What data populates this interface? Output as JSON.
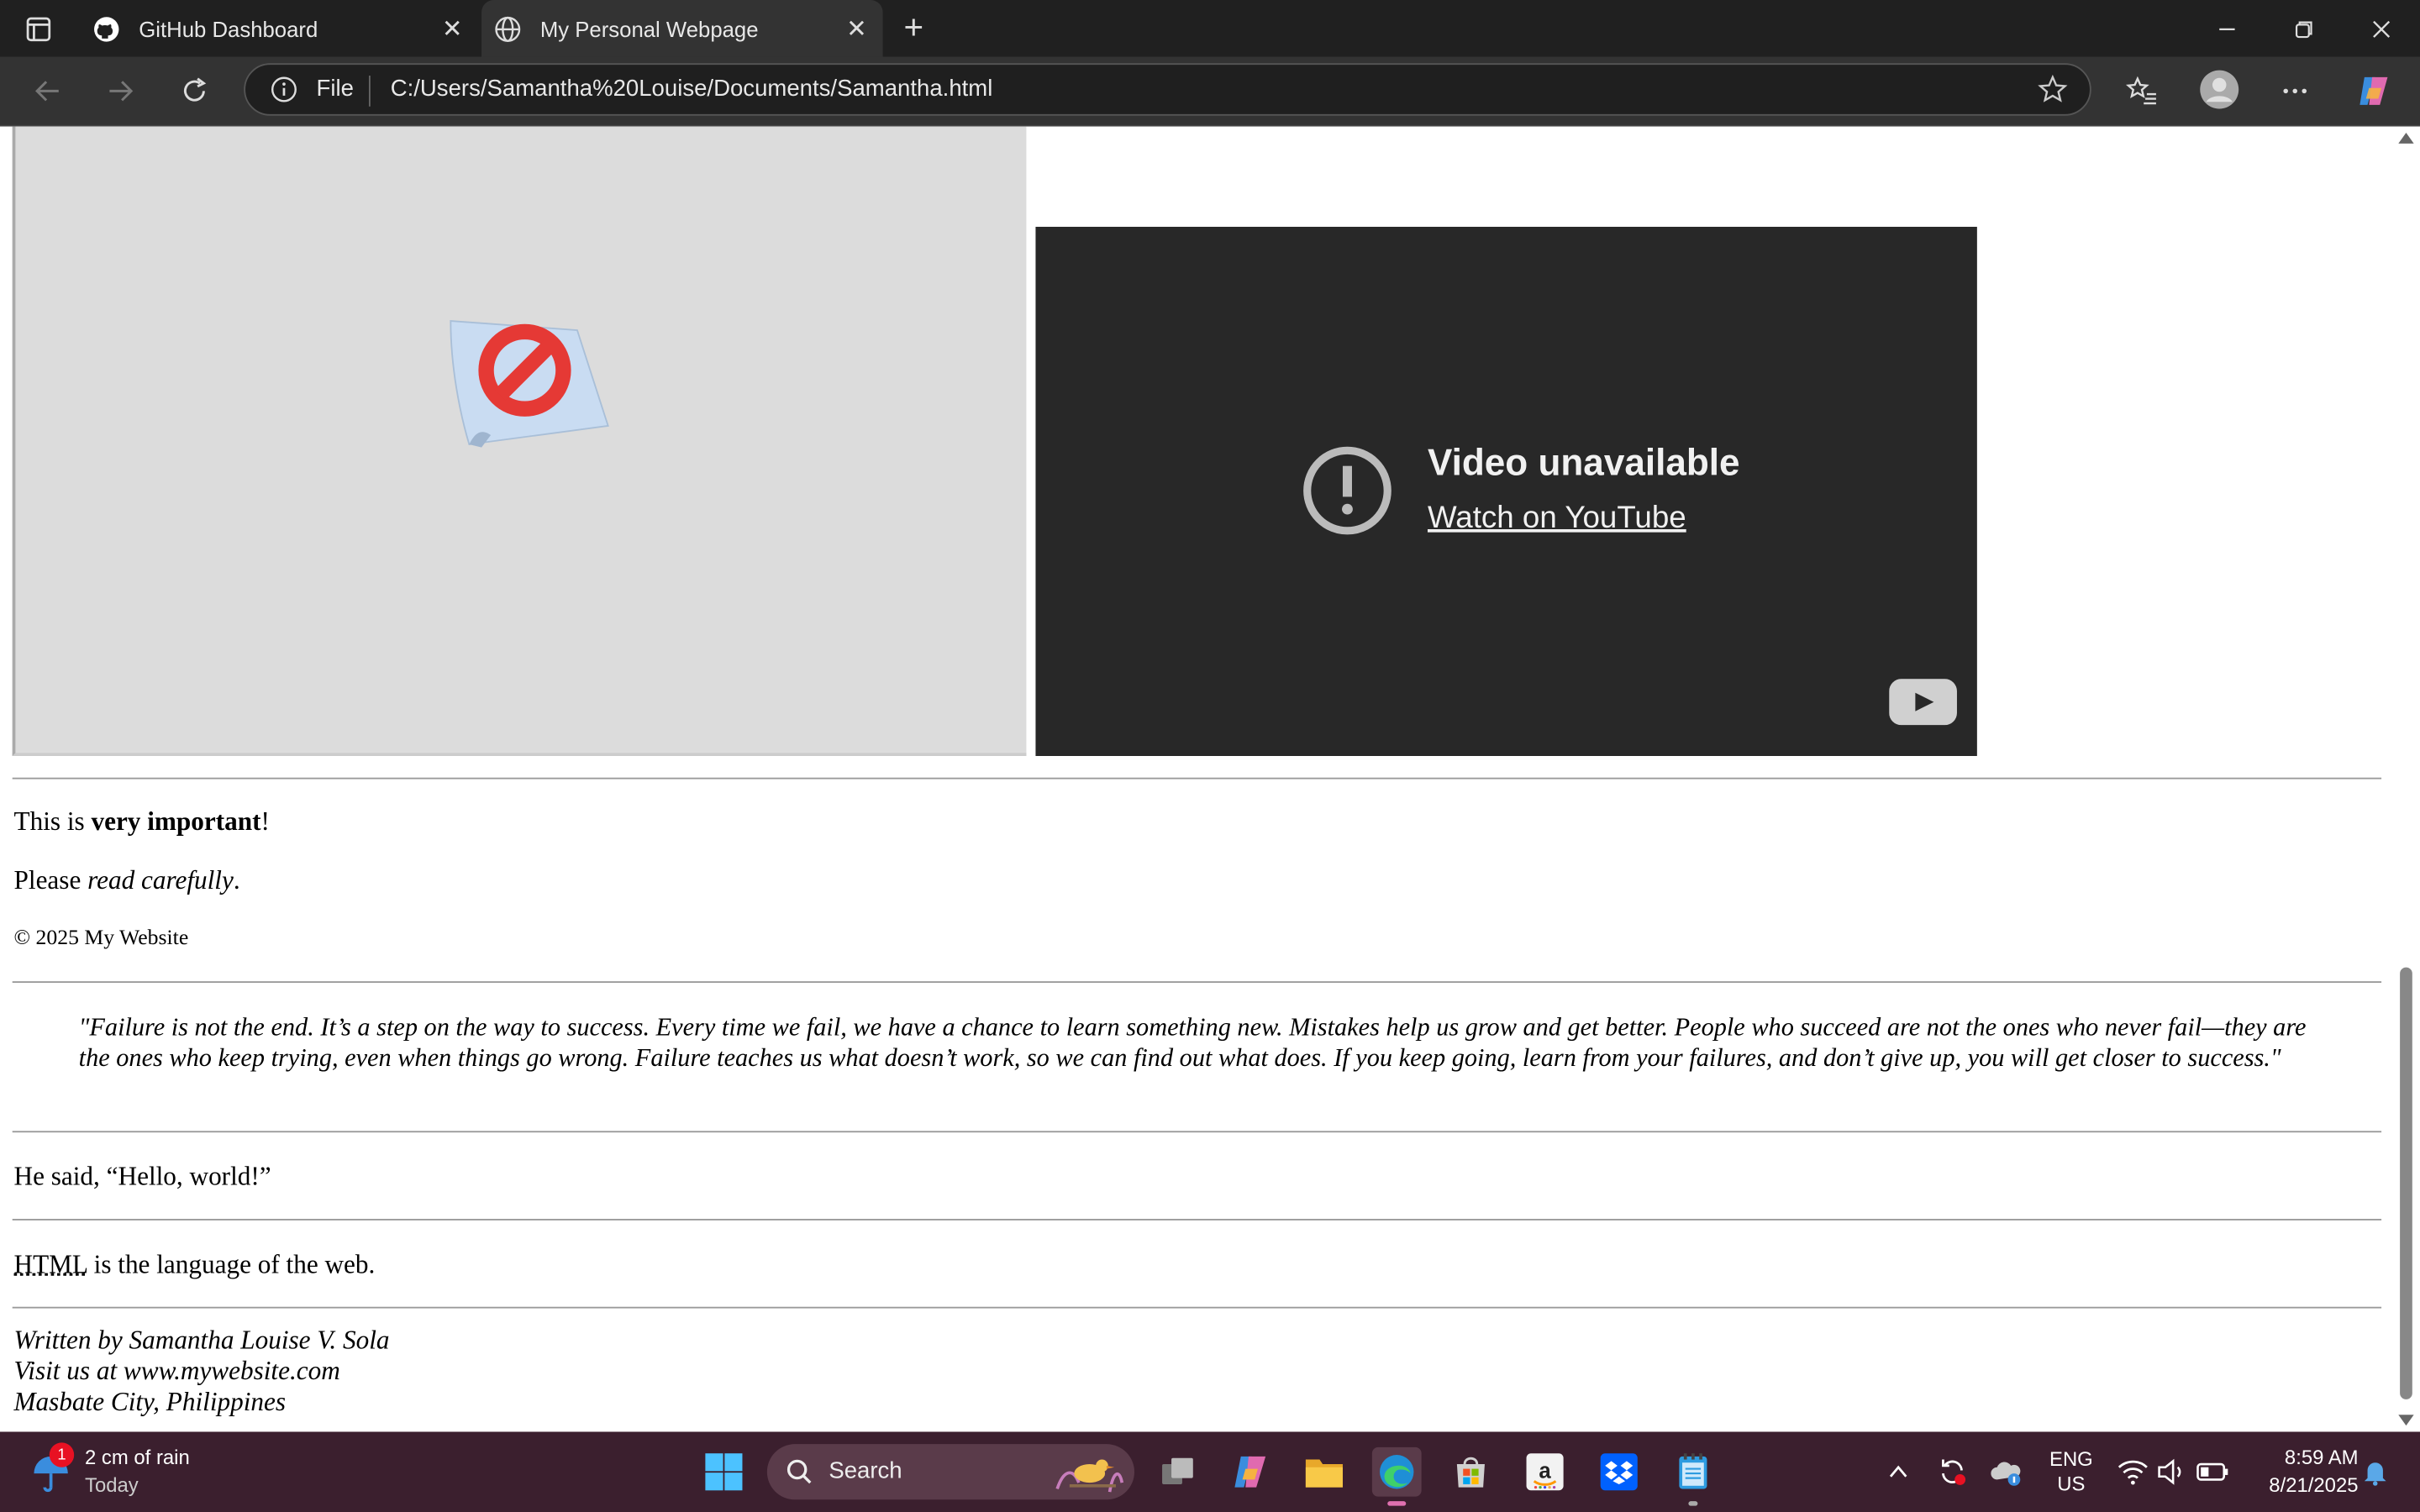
{
  "browser": {
    "tabs": [
      {
        "label": "GitHub Dashboard",
        "active": false,
        "icon": "github-icon"
      },
      {
        "label": "My Personal Webpage",
        "active": true,
        "icon": "globe-icon"
      }
    ],
    "address": {
      "scheme": "File",
      "url": "C:/Users/Samantha%20Louise/Documents/Samantha.html"
    }
  },
  "page": {
    "video": {
      "title": "Video unavailable",
      "link": "Watch on YouTube"
    },
    "line1": {
      "pre": "This is ",
      "bold": "very important",
      "post": "!"
    },
    "line2": {
      "pre": "Please ",
      "em": "read carefully",
      "post": "."
    },
    "copyright": "© 2025 My Website",
    "quote": "\"Failure is not the end. It’s a step on the way to success. Every time we fail, we have a chance to learn something new. Mistakes help us grow and get better. People who succeed are not the ones who never fail—they are the ones who keep trying, even when things go wrong. Failure teaches us what doesn’t work, so we can find out what does. If you keep going, learn from your failures, and don’t give up, you will get closer to success.\"",
    "said": {
      "pre": "He said, ",
      "q": "Hello, world!"
    },
    "abbr_line": {
      "abbr": "HTML",
      "post": " is the language of the web."
    },
    "address_block": {
      "line1": "Written by Samantha Louise V. Sola",
      "line2": "Visit us at www.mywebsite.com",
      "line3": "Masbate City, Philippines"
    }
  },
  "taskbar": {
    "weather": {
      "badge": "1",
      "line1": "2 cm of rain",
      "line2": "Today"
    },
    "search_label": "Search",
    "lang": {
      "line1": "ENG",
      "line2": "US"
    },
    "clock": {
      "time": "8:59 AM",
      "date": "8/21/2025"
    }
  },
  "colors": {
    "titlebar": "#202020",
    "toolbar": "#333333",
    "video_bg": "#282828",
    "taskbar": "#3b1f2e",
    "blocked_red": "#e53935"
  }
}
